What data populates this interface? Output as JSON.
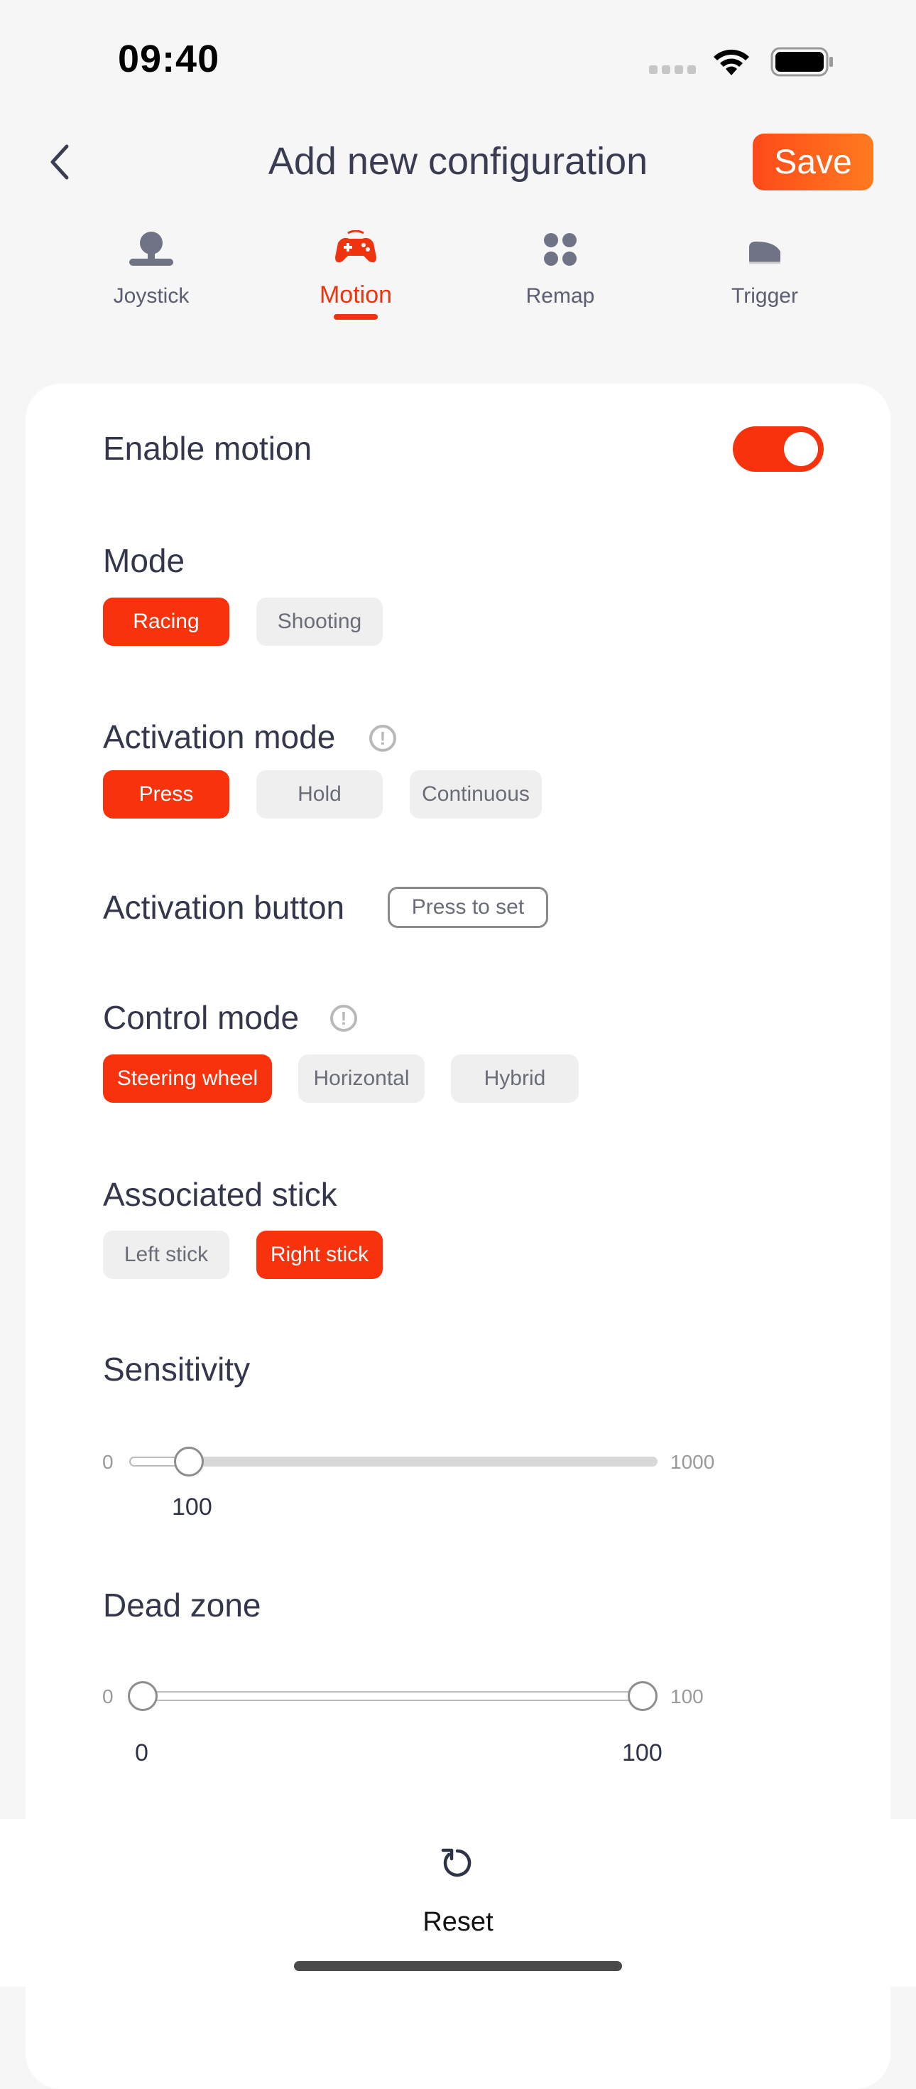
{
  "status": {
    "time": "09:40"
  },
  "header": {
    "title": "Add new configuration",
    "save_label": "Save"
  },
  "tabs": [
    {
      "label": "Joystick",
      "icon": "joystick-icon",
      "active": false
    },
    {
      "label": "Motion",
      "icon": "gamepad-motion-icon",
      "active": true
    },
    {
      "label": "Remap",
      "icon": "remap-dots-icon",
      "active": false
    },
    {
      "label": "Trigger",
      "icon": "trigger-icon",
      "active": false
    }
  ],
  "settings": {
    "enable_motion": {
      "label": "Enable motion",
      "enabled": true
    },
    "mode": {
      "label": "Mode",
      "options": [
        "Racing",
        "Shooting"
      ],
      "selected": "Racing"
    },
    "activation_mode": {
      "label": "Activation mode",
      "options": [
        "Press",
        "Hold",
        "Continuous"
      ],
      "selected": "Press"
    },
    "activation_button": {
      "label": "Activation button",
      "button_label": "Press to set"
    },
    "control_mode": {
      "label": "Control mode",
      "options": [
        "Steering wheel",
        "Horizontal",
        "Hybrid"
      ],
      "selected": "Steering wheel"
    },
    "associated_stick": {
      "label": "Associated stick",
      "options": [
        "Left stick",
        "Right stick"
      ],
      "selected": "Right stick"
    },
    "sensitivity": {
      "label": "Sensitivity",
      "min": "0",
      "max": "1000",
      "value": "100"
    },
    "dead_zone": {
      "label": "Dead zone",
      "min": "0",
      "max": "100",
      "low_value": "0",
      "high_value": "100"
    }
  },
  "footer": {
    "reset_label": "Reset"
  },
  "colors": {
    "accent": "#f7320c",
    "chip_bg": "#efefef",
    "background": "#f6f6f6"
  }
}
